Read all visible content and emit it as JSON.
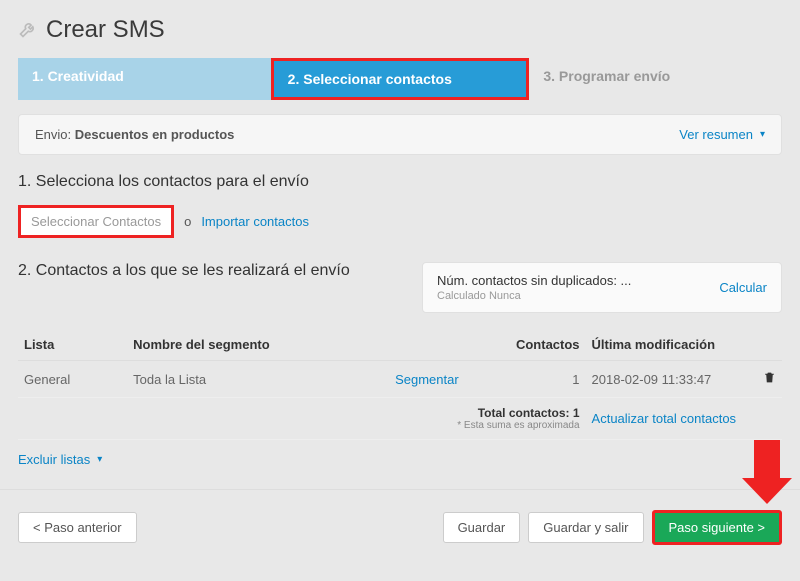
{
  "header": {
    "title": "Crear SMS"
  },
  "steps": {
    "s1": "1. Creatividad",
    "s2": "2. Seleccionar contactos",
    "s3": "3. Programar envío"
  },
  "envio": {
    "label": "Envio:",
    "name": "Descuentos en productos",
    "summary_link": "Ver resumen"
  },
  "section1": {
    "title": "1. Selecciona los contactos para el envío",
    "select_btn": "Seleccionar Contactos",
    "or": "o",
    "import_link": "Importar contactos"
  },
  "section2": {
    "title": "2. Contactos a los que se les realizará el envío",
    "calc_label": "Núm. contactos sin duplicados: ...",
    "calc_sub": "Calculado Nunca",
    "calc_link": "Calcular"
  },
  "table": {
    "headers": {
      "lista": "Lista",
      "nombre": "Nombre del segmento",
      "contactos": "Contactos",
      "modif": "Última modificación"
    },
    "rows": [
      {
        "lista": "General",
        "nombre": "Toda la Lista",
        "seg_link": "Segmentar",
        "contactos": "1",
        "fecha": "2018-02-09 11:33:47"
      }
    ],
    "total_label": "Total contactos: 1",
    "total_sub": "* Esta suma es aproximada",
    "update_link": "Actualizar total contactos"
  },
  "excluir": "Excluir listas",
  "footer": {
    "prev": "< Paso anterior",
    "save": "Guardar",
    "save_exit": "Guardar y salir",
    "next": "Paso siguiente >"
  }
}
